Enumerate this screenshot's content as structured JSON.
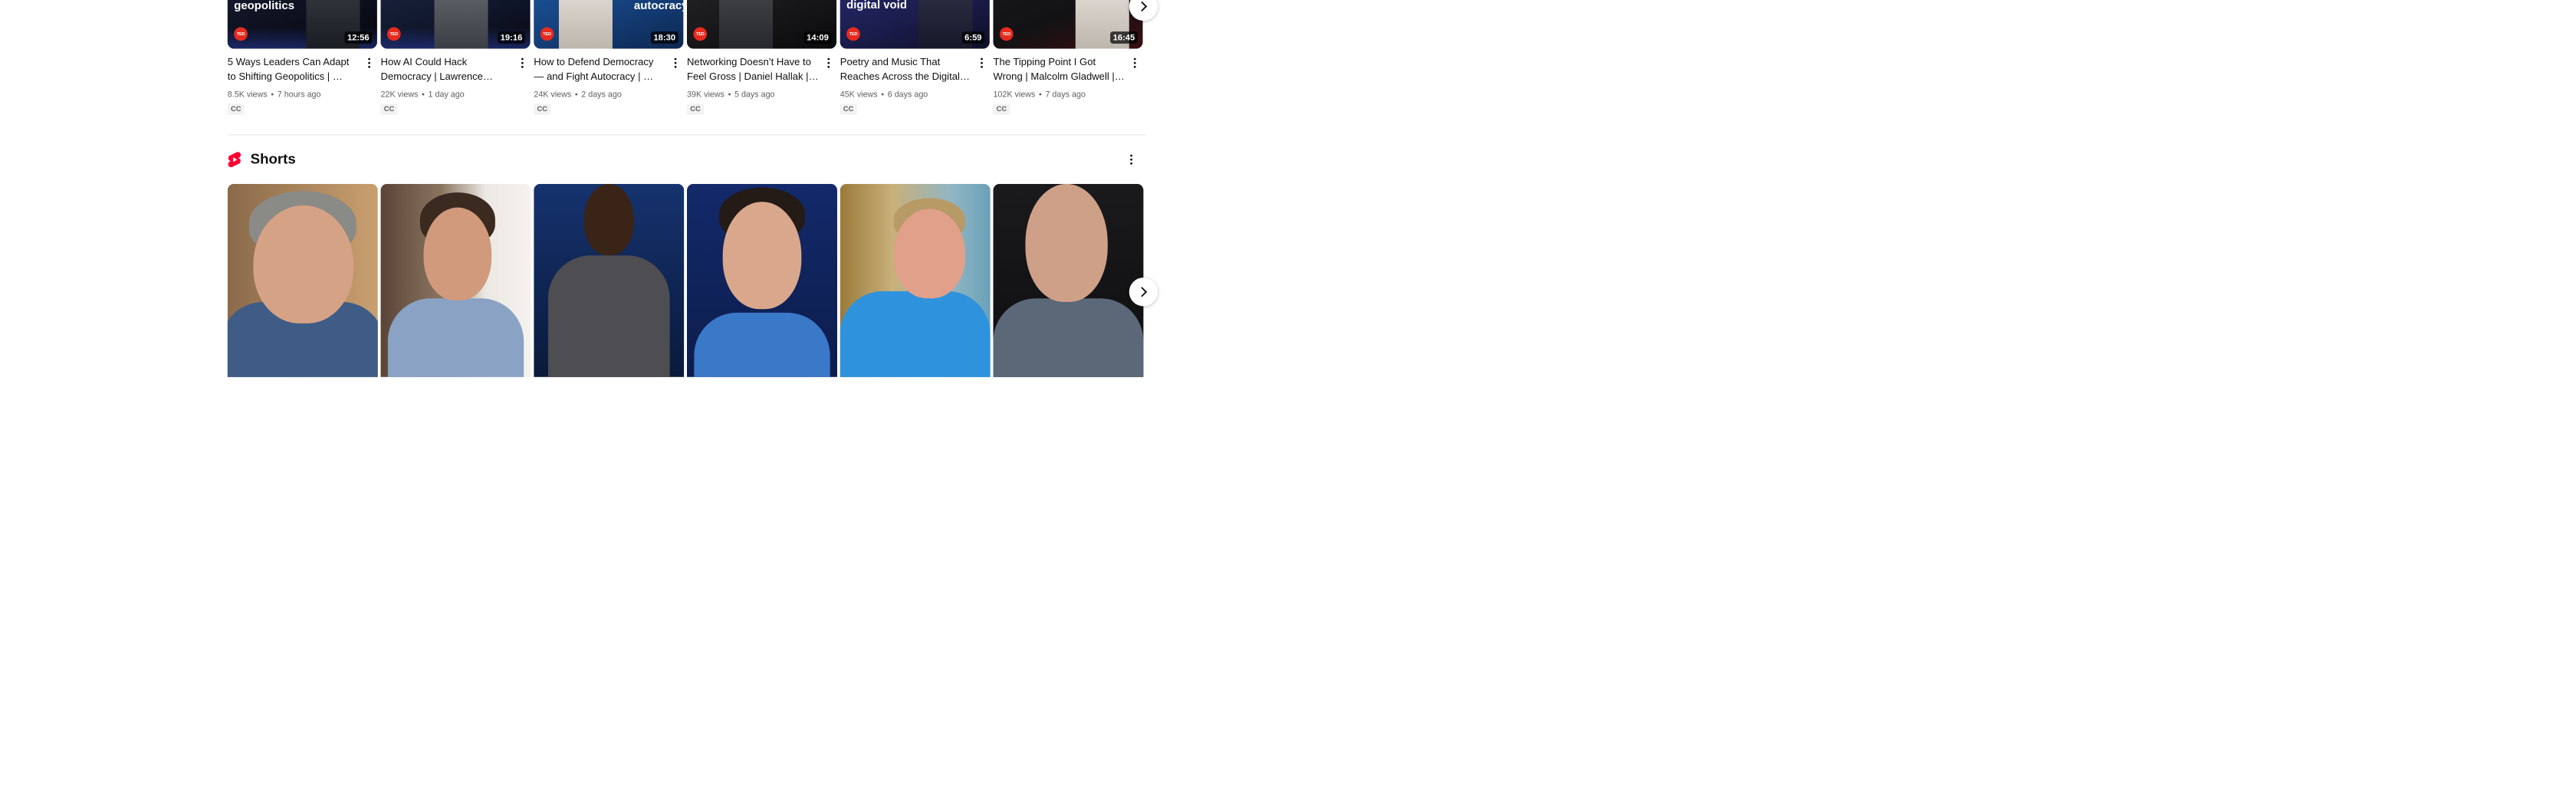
{
  "videos": [
    {
      "title": "5 Ways Leaders Can Adapt to Shifting Geopolitics | …",
      "thumb_text": "geopolitics",
      "duration": "12:56",
      "views": "8.5K views",
      "age": "7 hours ago",
      "badge": "CC",
      "channel_mark": "TED"
    },
    {
      "title": "How AI Could Hack Democracy | Lawrence…",
      "thumb_text": "",
      "duration": "19:16",
      "views": "22K views",
      "age": "1 day ago",
      "badge": "CC",
      "channel_mark": "TED"
    },
    {
      "title": "How to Defend Democracy — and Fight Autocracy | …",
      "thumb_text": "autocracy",
      "duration": "18:30",
      "views": "24K views",
      "age": "2 days ago",
      "badge": "CC",
      "channel_mark": "TED"
    },
    {
      "title": "Networking Doesn’t Have to Feel Gross | Daniel Hallak |…",
      "thumb_text": "",
      "duration": "14:09",
      "views": "39K views",
      "age": "5 days ago",
      "badge": "CC",
      "channel_mark": "TED"
    },
    {
      "title": "Poetry and Music That Reaches Across the Digital…",
      "thumb_text": "across the digital void",
      "duration": "6:59",
      "views": "45K views",
      "age": "6 days ago",
      "badge": "CC",
      "channel_mark": "TED"
    },
    {
      "title": "The Tipping Point I Got Wrong | Malcolm Gladwell |…",
      "thumb_text": "",
      "duration": "16:45",
      "views": "102K views",
      "age": "7 days ago",
      "badge": "CC",
      "channel_mark": "TED"
    }
  ],
  "meta_separator": "•",
  "shorts": {
    "title": "Shorts",
    "icon": "shorts-icon",
    "count": 6
  },
  "icons": {
    "next": "chevron-right-icon",
    "more": "more-vert-icon"
  },
  "colors": {
    "shorts_red": "#ff0033",
    "ted_red": "#e62b1e",
    "meta_gray": "#606060",
    "text": "#0f0f0f"
  }
}
